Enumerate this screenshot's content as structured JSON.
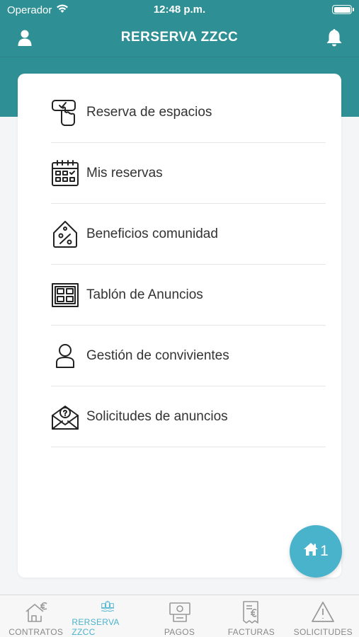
{
  "status_bar": {
    "carrier": "Operador",
    "time": "12:48 p.m."
  },
  "header": {
    "title": "RERSERVA ZZCC",
    "left_icon": "user-icon",
    "right_icon": "bell-icon"
  },
  "menu": {
    "items": [
      {
        "label": "Reserva de espacios",
        "icon": "hand-touch-icon"
      },
      {
        "label": "Mis reservas",
        "icon": "calendar-icon"
      },
      {
        "label": "Beneficios comunidad",
        "icon": "discount-tag-icon"
      },
      {
        "label": "Tablón de Anuncios",
        "icon": "bulletin-board-icon"
      },
      {
        "label": "Gestión de convivientes",
        "icon": "person-icon"
      },
      {
        "label": "Solicitudes de anuncios",
        "icon": "question-envelope-icon"
      }
    ]
  },
  "fab": {
    "count": "1",
    "icon": "home-icon"
  },
  "tabs": [
    {
      "label": "CONTRATOS",
      "icon": "house-euro-icon",
      "active": false
    },
    {
      "label": "RERSERVA ZZCC",
      "icon": "facilities-icon",
      "active": true
    },
    {
      "label": "PAGOS",
      "icon": "payment-icon",
      "active": false
    },
    {
      "label": "FACTURAS",
      "icon": "invoice-icon",
      "active": false
    },
    {
      "label": "SOLICITUDES",
      "icon": "warning-icon",
      "active": false
    }
  ],
  "colors": {
    "header": "#2e9094",
    "accent": "#4ab3cc",
    "background": "#f3f5f6"
  }
}
